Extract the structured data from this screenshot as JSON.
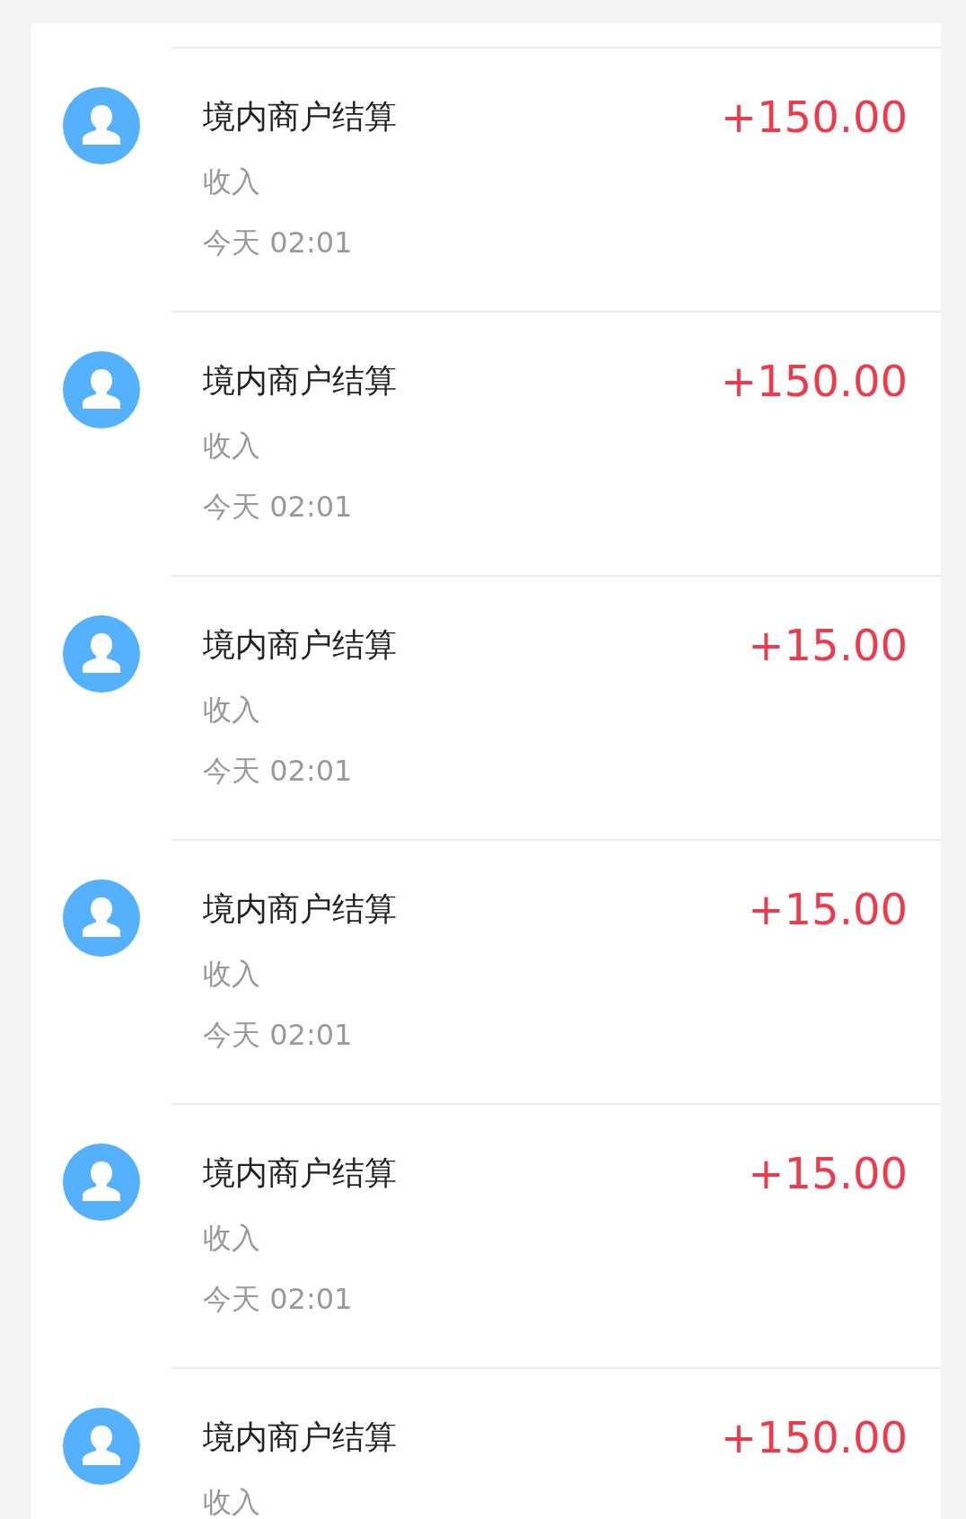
{
  "transactions": [
    {
      "title": "境内商户结算",
      "type": "收入",
      "time": "今天 02:01",
      "amount": "+150.00"
    },
    {
      "title": "境内商户结算",
      "type": "收入",
      "time": "今天 02:01",
      "amount": "+150.00"
    },
    {
      "title": "境内商户结算",
      "type": "收入",
      "time": "今天 02:01",
      "amount": "+15.00"
    },
    {
      "title": "境内商户结算",
      "type": "收入",
      "time": "今天 02:01",
      "amount": "+15.00"
    },
    {
      "title": "境内商户结算",
      "type": "收入",
      "time": "今天 02:01",
      "amount": "+15.00"
    },
    {
      "title": "境内商户结算",
      "type": "收入",
      "amount": "+150.00"
    }
  ]
}
